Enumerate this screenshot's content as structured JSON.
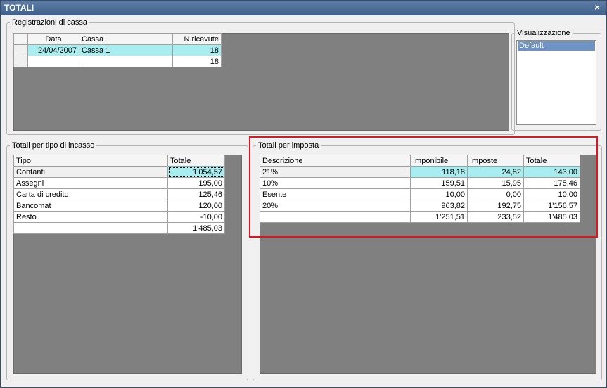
{
  "window": {
    "title": "TOTALI",
    "close_glyph": "×"
  },
  "registrazioni": {
    "legend": "Registrazioni di cassa",
    "headers": [
      "Data",
      "Cassa",
      "N.ricevute"
    ],
    "rows": [
      {
        "data": "24/04/2007",
        "cassa": "Cassa 1",
        "ricevute": "18"
      }
    ],
    "total": "18"
  },
  "visualizzazione": {
    "legend": "Visualizzazione",
    "items": [
      "Default"
    ]
  },
  "tipo_incasso": {
    "legend": "Totali per tipo di incasso",
    "headers": [
      "Tipo",
      "Totale"
    ],
    "rows": [
      {
        "tipo": "Contanti",
        "totale": "1'054,57"
      },
      {
        "tipo": "Assegni",
        "totale": "195,00"
      },
      {
        "tipo": "Carta di credito",
        "totale": "125,46"
      },
      {
        "tipo": "Bancomat",
        "totale": "120,00"
      },
      {
        "tipo": "Resto",
        "totale": "-10,00"
      }
    ],
    "total": "1'485,03"
  },
  "imposta": {
    "legend": "Totali per imposta",
    "headers": [
      "Descrizione",
      "Imponibile",
      "Imposte",
      "Totale"
    ],
    "rows": [
      {
        "descrizione": "21%",
        "imponibile": "118,18",
        "imposte": "24,82",
        "totale": "143,00"
      },
      {
        "descrizione": "10%",
        "imponibile": "159,51",
        "imposte": "15,95",
        "totale": "175,46"
      },
      {
        "descrizione": "Esente",
        "imponibile": "10,00",
        "imposte": "0,00",
        "totale": "10,00"
      },
      {
        "descrizione": "20%",
        "imponibile": "963,82",
        "imposte": "192,75",
        "totale": "1'156,57"
      }
    ],
    "totals": {
      "imponibile": "1'251,51",
      "imposte": "233,52",
      "totale": "1'485,03"
    }
  },
  "colors": {
    "selection": "#a8eef0",
    "list_selection": "#6f93c4",
    "annotation_box": "#e0141e",
    "empty_area": "#808080"
  }
}
